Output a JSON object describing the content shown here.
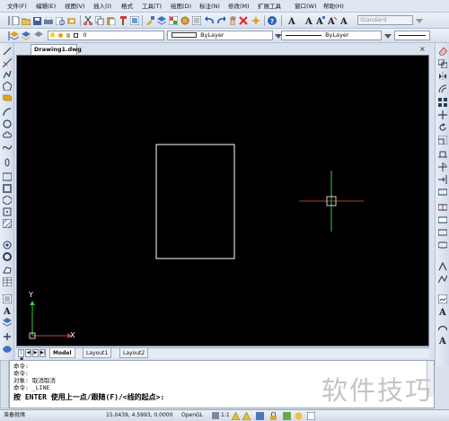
{
  "menu": [
    "文件(F)",
    "编辑(E)",
    "视图(V)",
    "插入(I)",
    "格式",
    "工具(T)",
    "绘图(D)",
    "标注(N)",
    "修改(M)",
    "扩展工具",
    "窗口(W)",
    "帮助(H)"
  ],
  "toolbar": {
    "text_style": "Standard",
    "layer_value": "0",
    "linetype_value": "ByLayer",
    "lineweight_value": "ByLayer",
    "layer_style_label": "——ByLayer"
  },
  "document": {
    "tab_title": "Drawing1.dwg",
    "close_glyph": "×"
  },
  "layout_tabs": [
    "Model",
    "Layout1",
    "Layout2"
  ],
  "ucs": {
    "x_label": "X",
    "y_label": "Y"
  },
  "command_lines": [
    "命令:",
    "命令:",
    "对象: 取消取消",
    "命令: _LINE"
  ],
  "command_prompt": "按 ENTER 使用上一点/跟随(F)/<线的起点>:",
  "status": {
    "left": "准备就绪",
    "coordinates": "15.0439, 4.5993, 0.0000",
    "render": "OpenGL",
    "scale": "1:1"
  },
  "watermark": "软件技巧",
  "colors": {
    "canvas": "#000000",
    "crosshair_h": "#c0392b",
    "crosshair_v": "#2ecc40",
    "ucs_x": "#d43b3b",
    "ucs_y": "#37c53a",
    "rect_stroke": "#ffffff"
  }
}
